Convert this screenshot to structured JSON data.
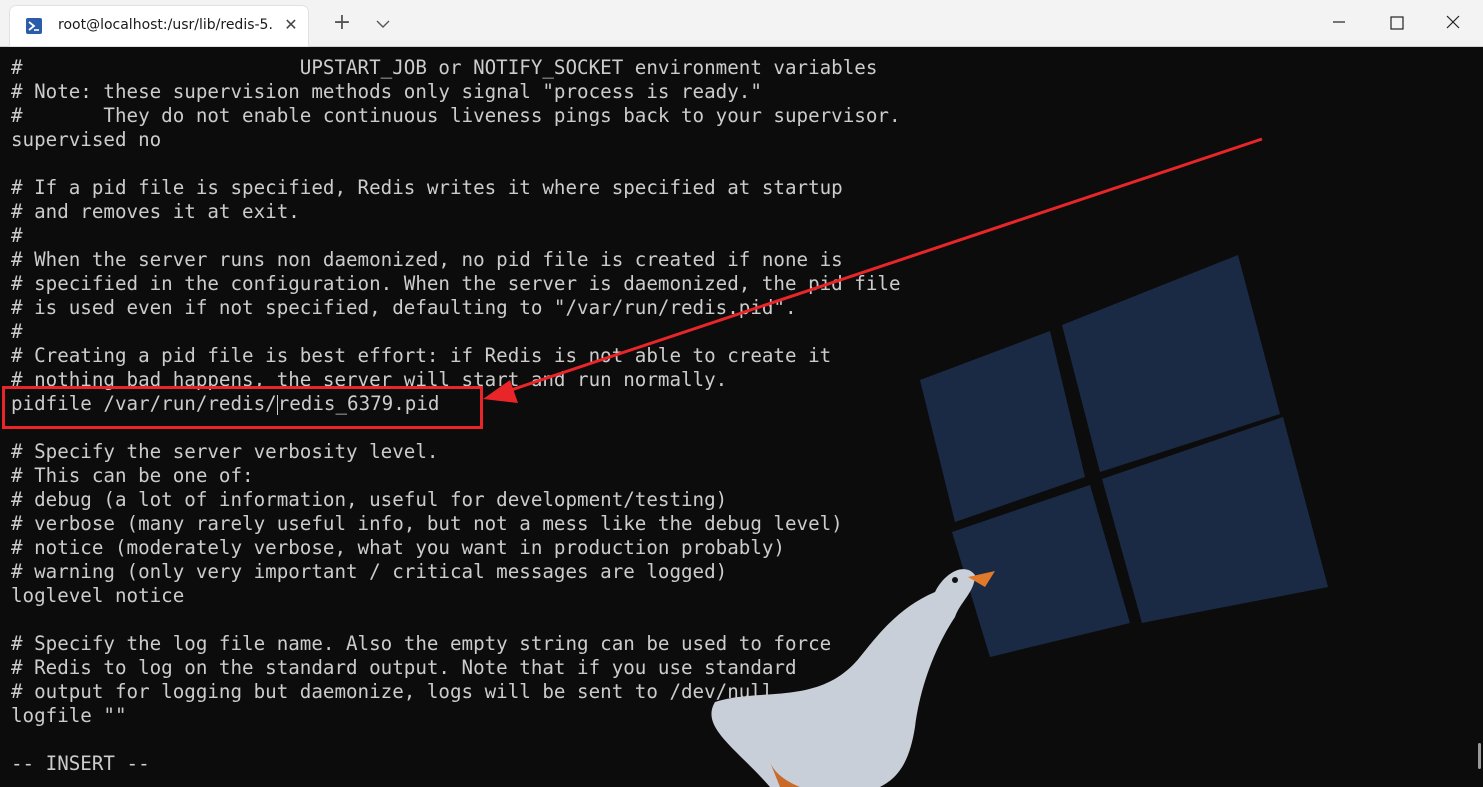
{
  "window": {
    "tab_title": "root@localhost:/usr/lib/redis-5.",
    "tab_close": "✕",
    "new_tab": "+",
    "icons": {
      "tab": "powershell-icon",
      "dropdown": "chevron-down-icon",
      "minimize": "minimize-icon",
      "maximize": "maximize-icon",
      "close": "close-icon"
    }
  },
  "terminal": {
    "lines": [
      "#                        UPSTART_JOB or NOTIFY_SOCKET environment variables",
      "# Note: these supervision methods only signal \"process is ready.\"",
      "#       They do not enable continuous liveness pings back to your supervisor.",
      "supervised no",
      "",
      "# If a pid file is specified, Redis writes it where specified at startup",
      "# and removes it at exit.",
      "#",
      "# When the server runs non daemonized, no pid file is created if none is",
      "# specified in the configuration. When the server is daemonized, the pid file",
      "# is used even if not specified, defaulting to \"/var/run/redis.pid\".",
      "#",
      "# Creating a pid file is best effort: if Redis is not able to create it",
      "# nothing bad happens, the server will start and run normally.",
      "pidfile /var/run/redis/redis_6379.pid",
      "",
      "# Specify the server verbosity level.",
      "# This can be one of:",
      "# debug (a lot of information, useful for development/testing)",
      "# verbose (many rarely useful info, but not a mess like the debug level)",
      "# notice (moderately verbose, what you want in production probably)",
      "# warning (only very important / critical messages are logged)",
      "loglevel notice",
      "",
      "# Specify the log file name. Also the empty string can be used to force",
      "# Redis to log on the standard output. Note that if you use standard",
      "# output for logging but daemonize, logs will be sent to /dev/null",
      "logfile \"\"",
      "",
      "-- INSERT --"
    ],
    "pidfile_before_cursor": "pidfile /var/run/redis/",
    "pidfile_after_cursor": "redis_6379.pid",
    "colors": {
      "background": "#0c0c0c",
      "foreground": "#cccccc",
      "annotation": "#e8262a"
    }
  }
}
